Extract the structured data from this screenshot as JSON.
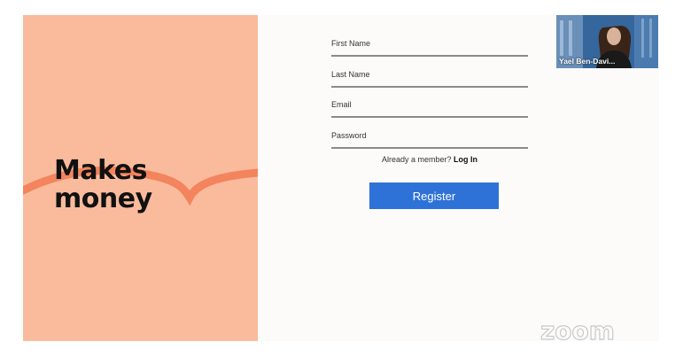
{
  "slide": {
    "headline_line1": "Makes",
    "headline_line2": "money",
    "panel_color": "#f9bb9c",
    "swoosh_color": "#f3845e"
  },
  "form": {
    "fields": [
      {
        "label": "First Name",
        "value": ""
      },
      {
        "label": "Last Name",
        "value": ""
      },
      {
        "label": "Email",
        "value": ""
      },
      {
        "label": "Password",
        "value": ""
      }
    ],
    "member_prompt": "Already a member?",
    "login_label": "Log In",
    "register_label": "Register",
    "button_color": "#2e72d8"
  },
  "video": {
    "participant_name": "Yael Ben-Davi..."
  },
  "branding": {
    "watermark": "zoom"
  }
}
